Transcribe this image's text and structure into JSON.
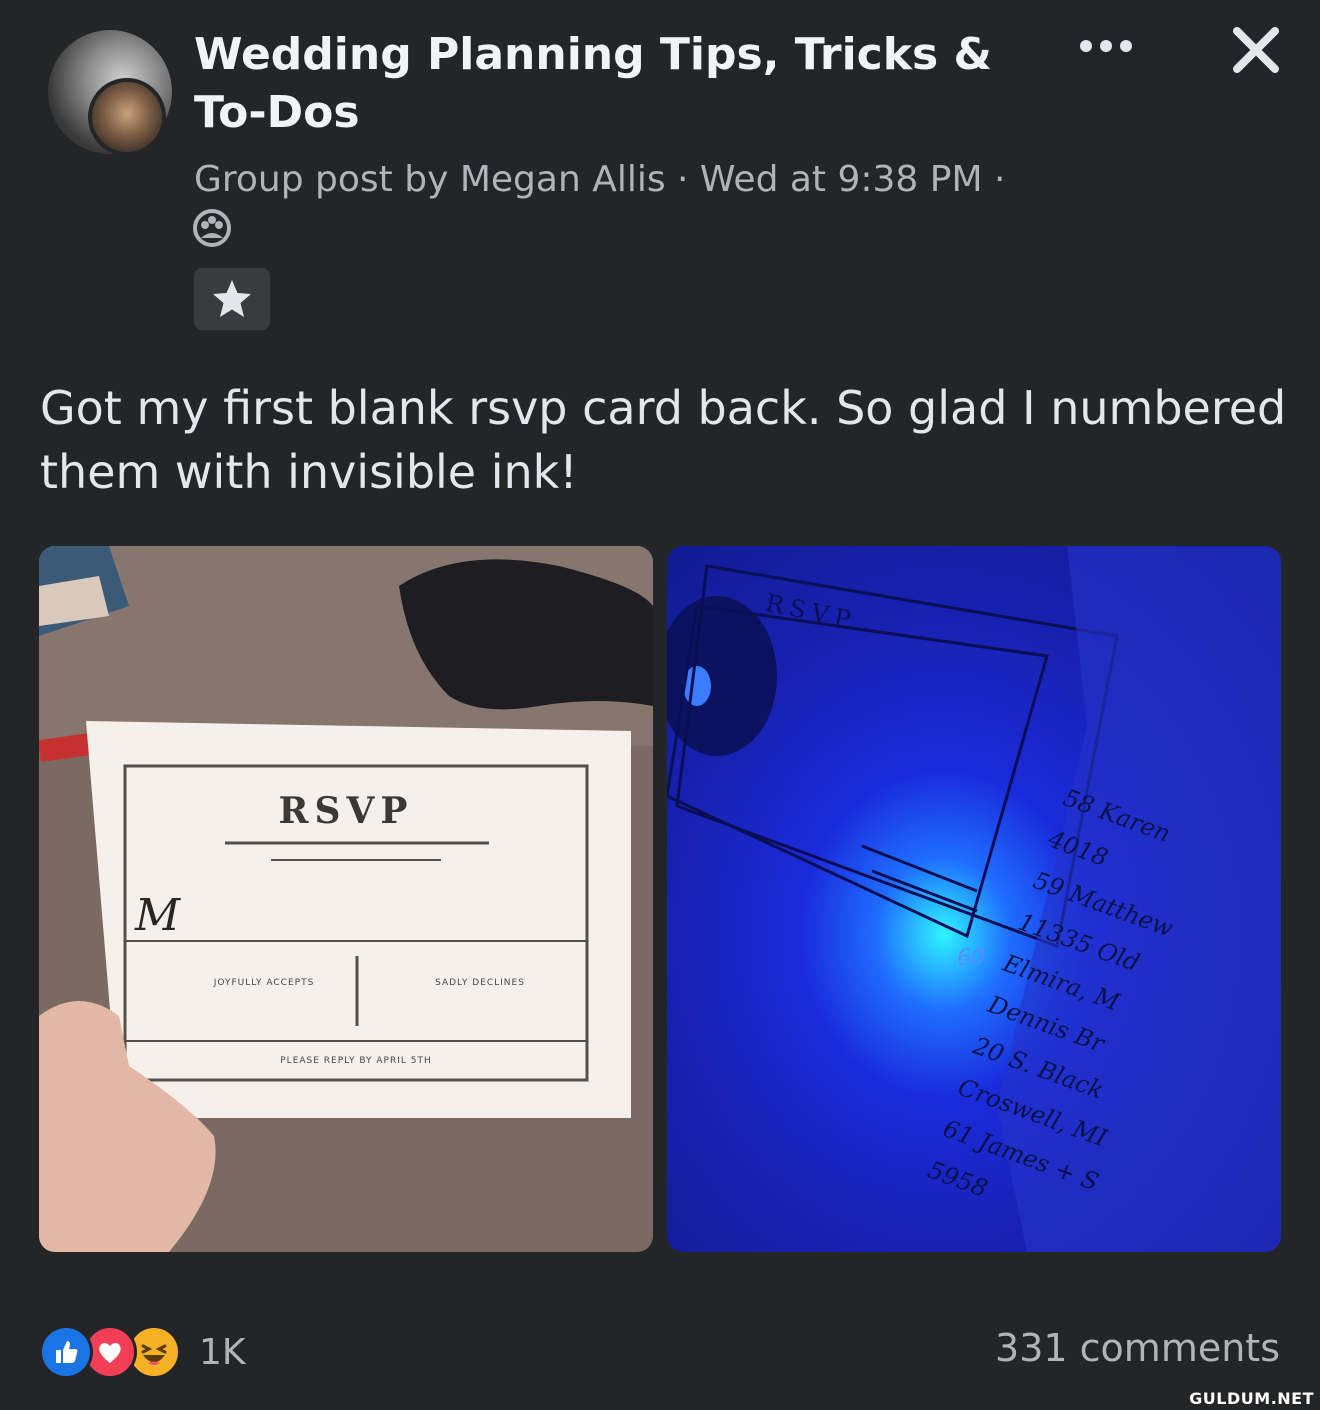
{
  "post": {
    "group_name": "Wedding Planning Tips, Tricks & To-Dos",
    "meta_line": "Group post by Megan Allis · Wed at 9:38 PM ·",
    "body_text": "Got my first blank rsvp card back. So glad I numbered them with invisible ink!"
  },
  "icons": {
    "more": "more-dots-icon",
    "close": "close-icon",
    "privacy": "group-privacy-icon",
    "star": "star-badge-icon"
  },
  "photo_left": {
    "card_title": "RSVP",
    "initial": "M",
    "accepts": "JOYFULLY ACCEPTS",
    "declines": "SADLY DECLINES",
    "reply_by": "PLEASE REPLY BY APRIL 5TH"
  },
  "photo_right": {
    "card_title": "RSVP",
    "number": "60",
    "list": [
      "58 Karen",
      "4018",
      "59 Matthew",
      "11335 Old",
      "Elmira, M",
      "Dennis Br",
      "20 S. Black",
      "Croswell, MI",
      "61 James + S",
      "5958"
    ]
  },
  "footer": {
    "reaction_count": "1K",
    "comments": "331 comments",
    "watermark": "GULDUM.NET"
  },
  "colors": {
    "background": "#242527",
    "like": "#1b74e4",
    "love": "#f33e58",
    "haha": "#f7b125"
  }
}
